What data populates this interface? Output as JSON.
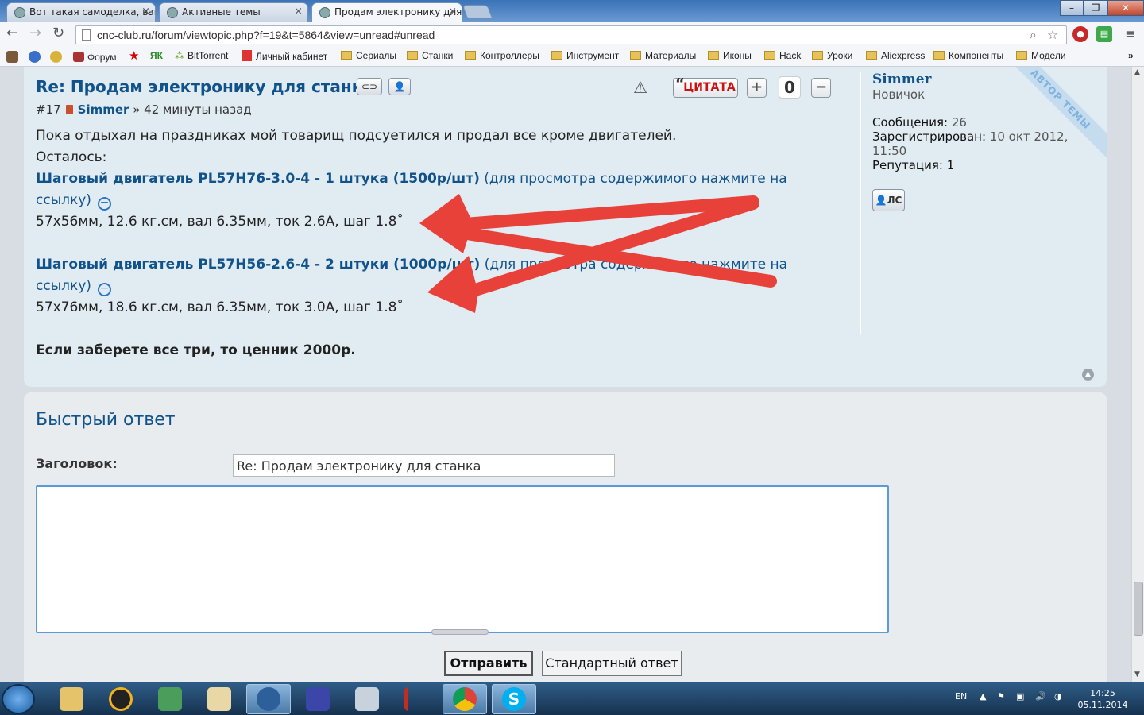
{
  "browser": {
    "tabs": [
      {
        "label": "Вот такая самоделка, ваш"
      },
      {
        "label": "Активные темы"
      },
      {
        "label": "Продам электронику для"
      }
    ],
    "url": "cnc-club.ru/forum/viewtopic.php?f=19&t=5864&view=unread#unread",
    "bookmarks": [
      {
        "label": "Форум"
      },
      {
        "label": "BitTorrent"
      },
      {
        "label": "Личный кабинет"
      },
      {
        "label": "Сериалы"
      },
      {
        "label": "Станки"
      },
      {
        "label": "Контроллеры"
      },
      {
        "label": "Инструмент"
      },
      {
        "label": "Материалы"
      },
      {
        "label": "Иконы"
      },
      {
        "label": "Hack"
      },
      {
        "label": "Уроки"
      },
      {
        "label": "Aliexpress"
      },
      {
        "label": "Компоненты"
      },
      {
        "label": "Модели"
      }
    ],
    "bookmarks_more": "»"
  },
  "post": {
    "title": "Re: Продам электронику для станка",
    "quote_label": "ЦИТАТА",
    "rating": "0",
    "number": "#17",
    "author": "Simmer",
    "time": "» 42 минуты назад",
    "lines": {
      "l1": "Пока отдыхал на праздниках мой товарищ подсуетился и продал все кроме двигателей.",
      "l2": "Осталось:",
      "item1_title": "Шаговый двигатель PL57H76-3.0-4 - 1 штука (1500р/шт)",
      "item1_hint_a": "(для просмотра содержимого нажмите на",
      "item1_hint_b": "ссылку)",
      "item1_specs": "57x56мм, 12.6 кг.см, вал 6.35мм, ток 2.6А, шаг 1.8˚",
      "item2_title": "Шаговый двигатель PL57H56-2.6-4 - 2 штуки (1000р/шт)",
      "item2_hint_a": "(для просмотра содержимого нажмите на",
      "item2_hint_b": "ссылку)",
      "item2_specs": "57x76мм, 18.6 кг.см, вал 6.35мм, ток 3.0А, шаг 1.8˚",
      "offer": "Если заберете все три, то ценник 2000р."
    }
  },
  "profile": {
    "name": "Simmer",
    "rank": "Новичок",
    "messages_label": "Сообщения:",
    "messages_value": "26",
    "registered_label": "Зарегистрирован:",
    "registered_value_a": "10 окт 2012,",
    "registered_value_b": "11:50",
    "reputation_label": "Репутация:",
    "reputation_value": "1",
    "pm_label": "ЛС",
    "ribbon": "АВТОР ТЕМЫ"
  },
  "quick_reply": {
    "title": "Быстрый ответ",
    "subject_label": "Заголовок:",
    "subject_value": "Re: Продам электронику для станка",
    "submit": "Отправить",
    "standard": "Стандартный ответ"
  },
  "taskbar": {
    "lang": "EN",
    "time": "14:25",
    "date": "05.11.2014"
  },
  "colors": {
    "link": "#105289",
    "post_bg": "#e1ebf2",
    "arrow": "#e8413a"
  }
}
